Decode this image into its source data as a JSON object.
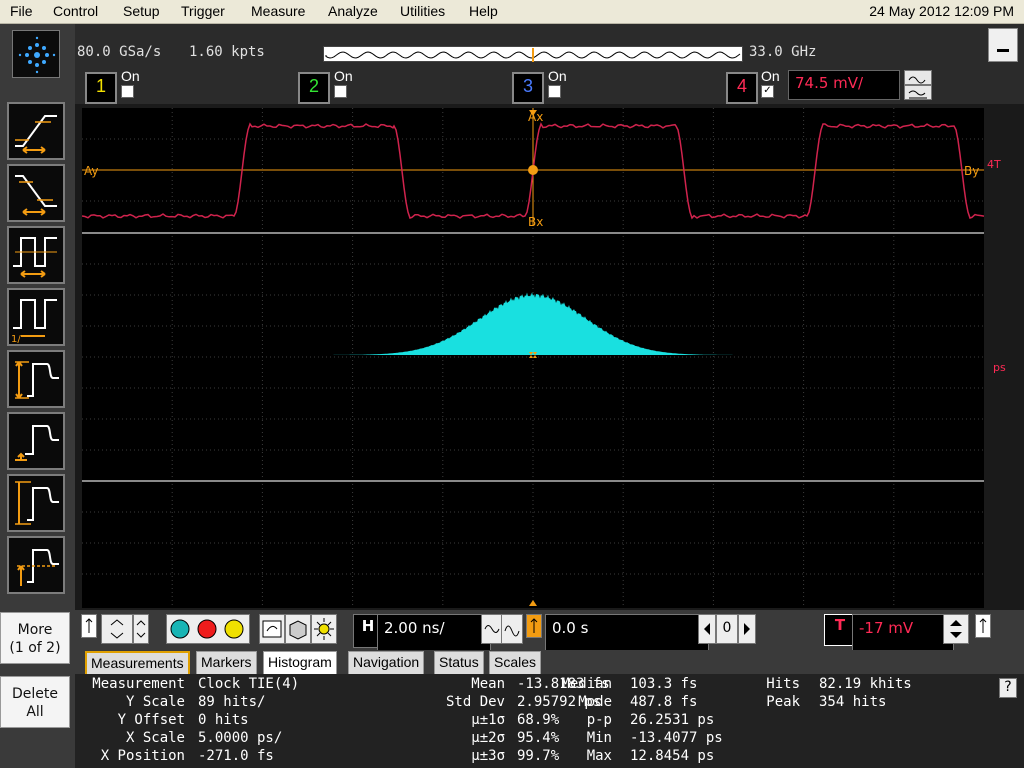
{
  "menu": [
    "File",
    "Control",
    "Setup",
    "Trigger",
    "Measure",
    "Analyze",
    "Utilities",
    "Help"
  ],
  "datetime": "24 May 2012 12:09 PM",
  "acq": {
    "sample_rate": "80.0 GSa/s",
    "points": "1.60 kpts",
    "bandwidth": "33.0 GHz"
  },
  "channels": [
    {
      "num": "1",
      "label": "On",
      "checked": false,
      "color": "#f4e200"
    },
    {
      "num": "2",
      "label": "On",
      "checked": false,
      "color": "#33e633"
    },
    {
      "num": "3",
      "label": "On",
      "checked": false,
      "color": "#4a7bff"
    },
    {
      "num": "4",
      "label": "On",
      "checked": true,
      "color": "#ff2a55"
    }
  ],
  "ch4_scale": "74.5 mV/",
  "markers": {
    "ax": "Ax",
    "bx": "Bx",
    "ay": "Ay",
    "by": "By",
    "trig": "4T",
    "hist_ref": "ps"
  },
  "side_buttons": {
    "more_line1": "More",
    "more_line2": "(1 of 2)",
    "delete_line1": "Delete",
    "delete_line2": "All"
  },
  "horizontal": {
    "label": "H",
    "scale": "2.00 ns/",
    "delay": "0.0 s"
  },
  "trigger": {
    "label": "T",
    "level": "-17 mV"
  },
  "tabs": [
    "Measurements",
    "Markers",
    "Histogram",
    "Navigation",
    "Status",
    "Scales"
  ],
  "active_tab": "Histogram",
  "meas": {
    "c1": [
      {
        "k": "Measurement",
        "v": "Clock TIE(4)"
      },
      {
        "k": "Y Scale",
        "v": "89 hits/"
      },
      {
        "k": "Y Offset",
        "v": "0 hits"
      },
      {
        "k": "X Scale",
        "v": "5.0000 ps/"
      },
      {
        "k": "X Position",
        "v": "-271.0 fs"
      }
    ],
    "c2": [
      {
        "k": "Mean",
        "v": "-13.8183 fs"
      },
      {
        "k": "Std Dev",
        "v": "2.95792 ps"
      },
      {
        "k": "μ±1σ",
        "v": "68.9%"
      },
      {
        "k": "μ±2σ",
        "v": "95.4%"
      },
      {
        "k": "μ±3σ",
        "v": "99.7%"
      }
    ],
    "c3": [
      {
        "k": "Median",
        "v": "103.3 fs"
      },
      {
        "k": "Mode",
        "v": "487.8 fs"
      },
      {
        "k": "p-p",
        "v": "26.2531 ps"
      },
      {
        "k": "Min",
        "v": "-13.4077 ps"
      },
      {
        "k": "Max",
        "v": "12.8454 ps"
      }
    ],
    "c4": [
      {
        "k": "Hits",
        "v": "82.19 khits"
      },
      {
        "k": "Peak",
        "v": "354 hits"
      }
    ]
  },
  "help_label": "?",
  "ctl_zero": "0",
  "colors": {
    "waveform": "#d0234d",
    "histogram": "#19e0e0",
    "marker": "#f39c12",
    "grid": "#3c3c3c"
  }
}
